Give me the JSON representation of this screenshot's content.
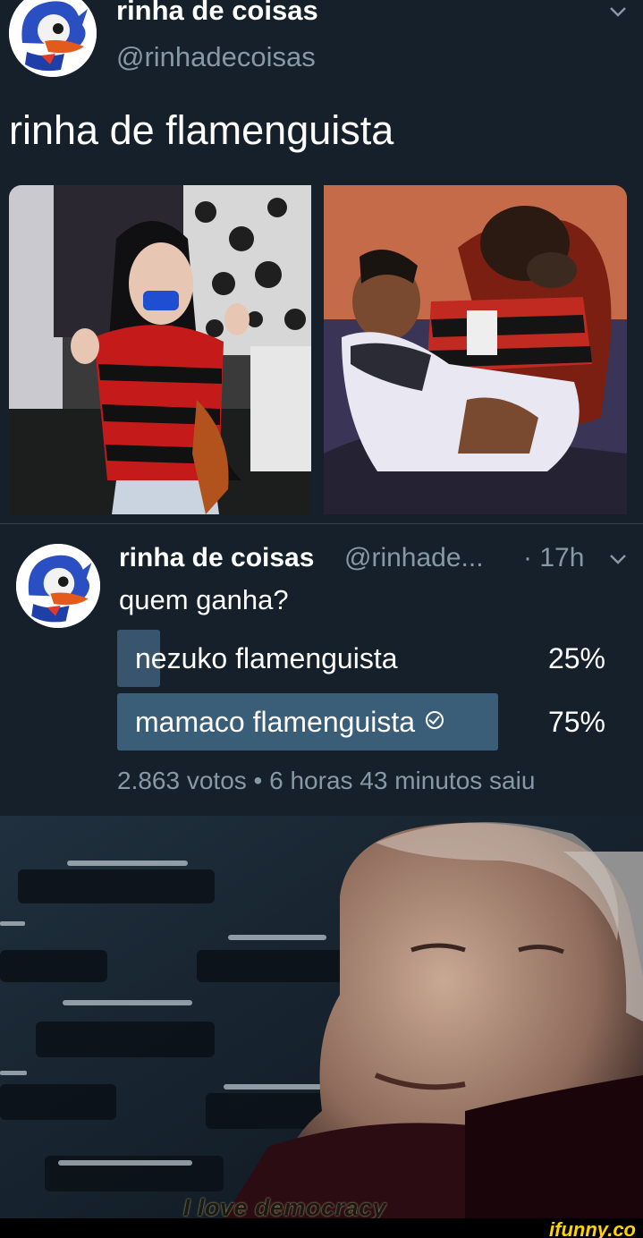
{
  "tweet": {
    "author_name": "rinha de coisas",
    "author_handle": "@rinhadecoisas",
    "text": "rinha de flamenguista"
  },
  "poll_tweet": {
    "author_name": "rinha de coisas",
    "author_handle": "@rinhade...",
    "time": "· 17h",
    "text": "quem ganha?",
    "options": [
      {
        "label": "nezuko flamenguista",
        "percent_text": "25%",
        "percent": 25,
        "winner": false
      },
      {
        "label": "mamaco flamenguista",
        "percent_text": "75%",
        "percent": 75,
        "winner": true
      }
    ],
    "meta": "2.863 votos • 6 horas 43 minutos saiu"
  },
  "meme": {
    "caption": "I love democracy"
  },
  "footer": {
    "brand": "ifunny.co"
  },
  "colors": {
    "background": "#15202b",
    "secondary_text": "#8899a6",
    "poll_bar": "#38556d",
    "brand": "#ffd400"
  },
  "icons": [
    "avatar-mascot-icon",
    "chevron-down-icon",
    "checkmark-circle-icon"
  ]
}
